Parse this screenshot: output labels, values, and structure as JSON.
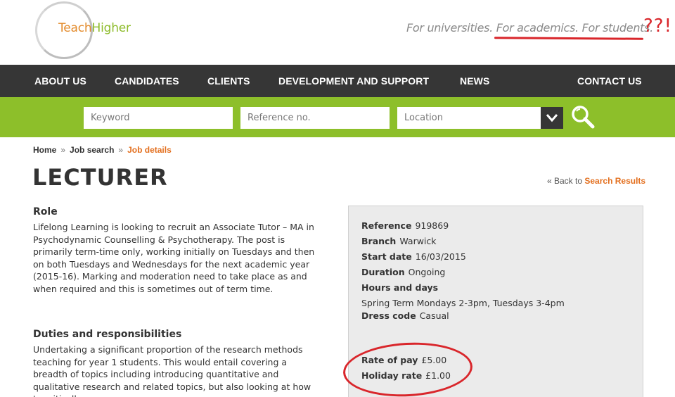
{
  "header": {
    "logo": {
      "part1": "Teach",
      "part2": "Higher"
    },
    "tagline": "For universities. For academics. For students.",
    "scribble": "??!"
  },
  "nav": {
    "items": [
      {
        "label": "ABOUT US"
      },
      {
        "label": "CANDIDATES"
      },
      {
        "label": "CLIENTS"
      },
      {
        "label": "DEVELOPMENT AND SUPPORT"
      },
      {
        "label": "NEWS"
      },
      {
        "label": "CONTACT US"
      }
    ]
  },
  "search": {
    "keyword_placeholder": "Keyword",
    "reference_placeholder": "Reference no.",
    "location_placeholder": "Location"
  },
  "breadcrumb": {
    "home": "Home",
    "sep": "»",
    "job_search": "Job search",
    "current": "Job details"
  },
  "page": {
    "title": "LECTURER",
    "back_prefix": "« Back to ",
    "back_link": "Search Results"
  },
  "role": {
    "heading": "Role",
    "body": "Lifelong Learning is looking to recruit an Associate Tutor – MA in Psychodynamic Counselling & Psychotherapy. The post is primarily term-time only, working initially on Tuesdays and then on both Tuesdays and Wednesdays for the next academic year (2015-16). Marking and moderation need to take place as and when required and this is sometimes out of term time."
  },
  "duties": {
    "heading": "Duties and responsibilities",
    "body": "Undertaking a significant proportion of the research methods teaching for year 1 students. This would entail covering a breadth of topics including introducing quantitative and qualitative research and related topics, but also looking at how to critically"
  },
  "details": {
    "reference": {
      "label": "Reference",
      "value": "919869"
    },
    "branch": {
      "label": "Branch",
      "value": "Warwick"
    },
    "start_date": {
      "label": "Start date",
      "value": "16/03/2015"
    },
    "duration": {
      "label": "Duration",
      "value": "Ongoing"
    },
    "hours": {
      "label": "Hours and days",
      "value": "Spring Term Mondays 2-3pm, Tuesdays 3-4pm"
    },
    "dress": {
      "label": "Dress code",
      "value": "Casual"
    },
    "rate": {
      "label": "Rate of pay",
      "value": "£5.00"
    },
    "holiday": {
      "label": "Holiday rate",
      "value": "£1.00"
    }
  },
  "colors": {
    "nav_bg": "#363636",
    "search_bg": "#8dbf2a",
    "accent_orange": "#e36f1e",
    "annotation_red": "#d9262b"
  },
  "icons": {
    "search": "search-icon",
    "dropdown": "chevron-down-icon"
  }
}
